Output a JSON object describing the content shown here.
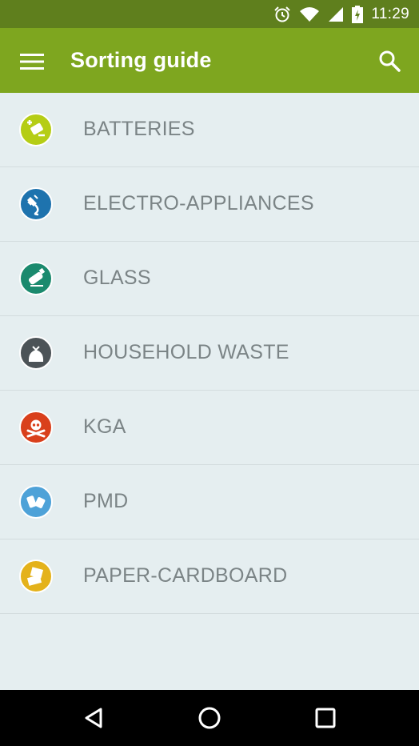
{
  "status_bar": {
    "time": "11:29",
    "icons": [
      "alarm-icon",
      "wifi-icon",
      "cell-signal-icon",
      "battery-charging-icon"
    ]
  },
  "app_bar": {
    "title": "Sorting guide",
    "menu_icon": "hamburger-menu-icon",
    "search_icon": "search-icon",
    "color": "#7ea61f"
  },
  "categories": [
    {
      "label": "BATTERIES",
      "icon": "battery-icon",
      "color": "#b5cd15"
    },
    {
      "label": "ELECTRO-APPLIANCES",
      "icon": "plug-icon",
      "color": "#1e73ae"
    },
    {
      "label": "GLASS",
      "icon": "bottle-icon",
      "color": "#1b8a6e"
    },
    {
      "label": "HOUSEHOLD WASTE",
      "icon": "trash-bag-icon",
      "color": "#4c5357"
    },
    {
      "label": "KGA",
      "icon": "skull-crossbones-icon",
      "color": "#d9401c"
    },
    {
      "label": "PMD",
      "icon": "can-bottle-icon",
      "color": "#4ea2d8"
    },
    {
      "label": "PAPER-CARDBOARD",
      "icon": "paper-box-icon",
      "color": "#e4b21b"
    }
  ],
  "nav_bar": {
    "back_icon": "back-triangle-icon",
    "home_icon": "home-circle-icon",
    "recents_icon": "recents-square-icon"
  }
}
